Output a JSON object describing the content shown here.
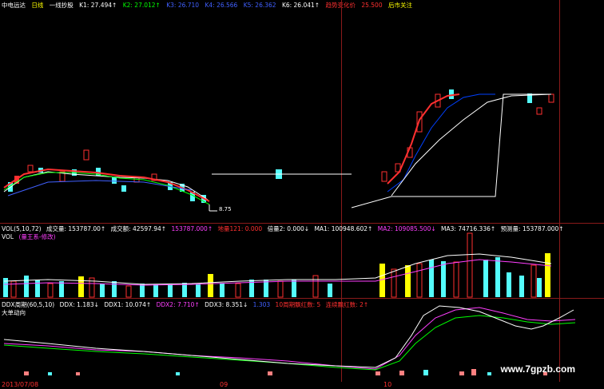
{
  "header": {
    "stock_name": "中电远达",
    "period": "日线",
    "indicator": "一线抄股",
    "k1": "K1: 27.494↑",
    "k2": "K2: 27.012↑",
    "k3": "K3: 26.710",
    "k4": "K4: 26.566",
    "k5": "K5: 26.362",
    "k6": "K6: 26.041↑",
    "trend_label": "趋势变化价",
    "trend_value": "25.500",
    "extra": "后市关注"
  },
  "main_chart": {
    "low_label": "8.75"
  },
  "volume_panel": {
    "name": "VOL(5,10,72)",
    "volume": "成交量: 153787.00↑",
    "amount": "成交额: 42597.94↑",
    "vol_value": "153787.000↑",
    "huge": "地量121: 0.000",
    "ratio": "倍量2: 0.000↓",
    "ma1": "MA1: 100948.602↑",
    "ma2": "MA2: 109085.500↓",
    "ma3": "MA3: 74716.336↑",
    "forecast": "预测量: 153787.000↑",
    "sub_name": "VOL",
    "sub_note": "(量王系-修改)"
  },
  "ddx_panel": {
    "name": "DDX周期(60,5,10)",
    "ddx": "DDX: 1.183↓",
    "ddx1": "DDX1: 10.074↑",
    "ddx2": "DDX2: 7.710↑",
    "ddx3": "DDX3: 8.351↓",
    "ddx4": "1.303",
    "red_days": "10周期飘红数: 5",
    "continuous": "连续飘红数: 2↑",
    "sub_name": "大单动向"
  },
  "x_axis": {
    "labels": [
      "2013/07/08",
      "09",
      "10"
    ]
  },
  "watermark": "www.7gpzb.com",
  "colors": {
    "up": "#ff3030",
    "down": "#54fcfc",
    "yellow": "#ffff00",
    "grid": "#8a1a1a"
  }
}
